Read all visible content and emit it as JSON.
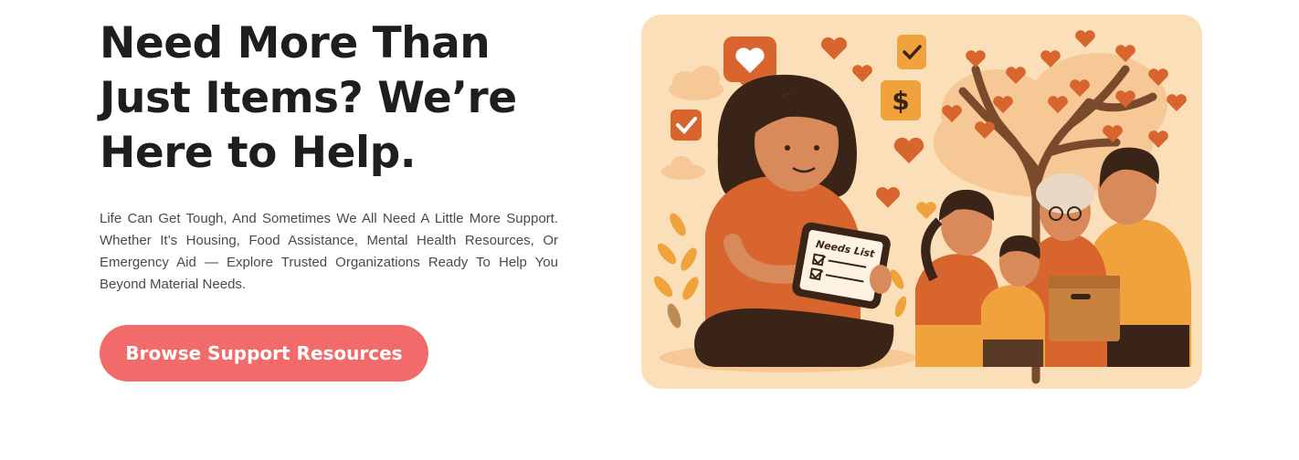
{
  "hero": {
    "heading": "Need More Than Just Items? We’re Here to Help.",
    "description": "Life Can Get Tough, And Sometimes We All Need A Little More Support. Whether It’s Housing, Food Assistance, Mental Health Resources, Or Emergency Aid — Explore Trusted Organizations Ready To Help You Beyond Material Needs.",
    "cta_label": "Browse Support Resources"
  },
  "illustration": {
    "clipboard_title": "Needs List",
    "icon_names": [
      "heart-speech-bubble-icon",
      "checkbox-icon",
      "dollar-icon",
      "heart-icon",
      "tree-icon",
      "cloud-icon"
    ]
  },
  "colors": {
    "accent": "#f26b6b",
    "heading": "#1e1e1e",
    "body": "#4a4a4a",
    "illustration_bg": "#fbdfb8",
    "orange": "#d9652e"
  }
}
